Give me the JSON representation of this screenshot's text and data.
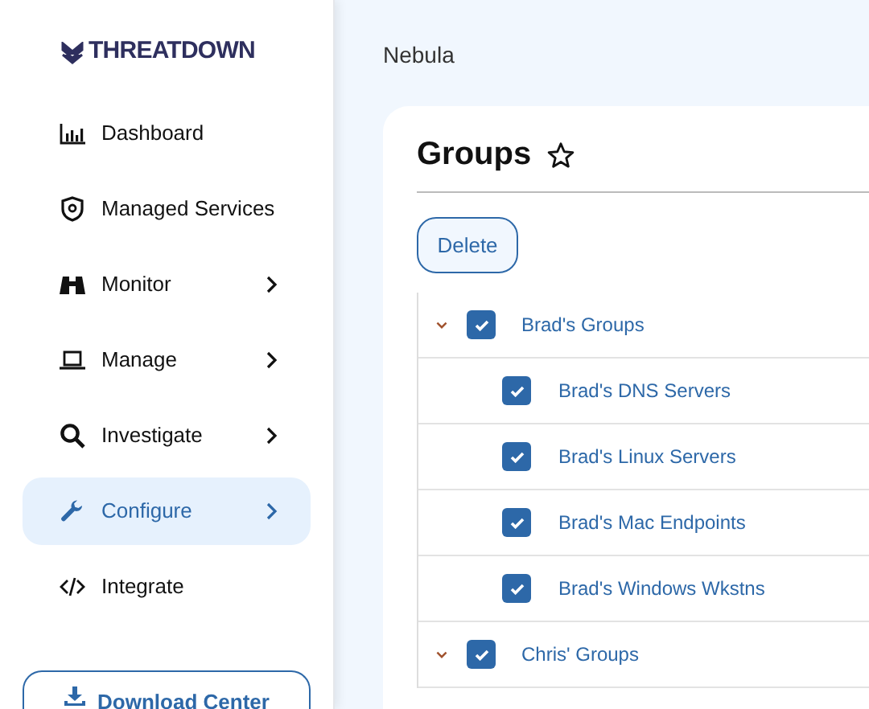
{
  "sidebar": {
    "logo": "THREATDOWN",
    "items": [
      {
        "label": "Dashboard",
        "kind": "chart",
        "has_submenu": false,
        "selected": false
      },
      {
        "label": "Managed Services",
        "kind": "shield",
        "has_submenu": false,
        "selected": false
      },
      {
        "label": "Monitor",
        "kind": "binoculars",
        "has_submenu": true,
        "selected": false
      },
      {
        "label": "Manage",
        "kind": "laptop",
        "has_submenu": true,
        "selected": false
      },
      {
        "label": "Investigate",
        "kind": "search",
        "has_submenu": true,
        "selected": false
      },
      {
        "label": "Configure",
        "kind": "wrench",
        "has_submenu": true,
        "selected": true
      },
      {
        "label": "Integrate",
        "kind": "code",
        "has_submenu": false,
        "selected": false
      }
    ],
    "download_button": "Download Center"
  },
  "breadcrumb": "Nebula",
  "page": {
    "title": "Groups",
    "favorite": false,
    "delete_button": "Delete",
    "groups": [
      {
        "name": "Brad's Groups",
        "checked": true,
        "expanded": true,
        "children": [
          {
            "name": "Brad's DNS Servers",
            "checked": true
          },
          {
            "name": "Brad's Linux Servers",
            "checked": true
          },
          {
            "name": "Brad's Mac Endpoints",
            "checked": true
          },
          {
            "name": "Brad's Windows Wkstns",
            "checked": true
          }
        ]
      },
      {
        "name": "Chris' Groups",
        "checked": true,
        "expanded": true
      }
    ]
  }
}
